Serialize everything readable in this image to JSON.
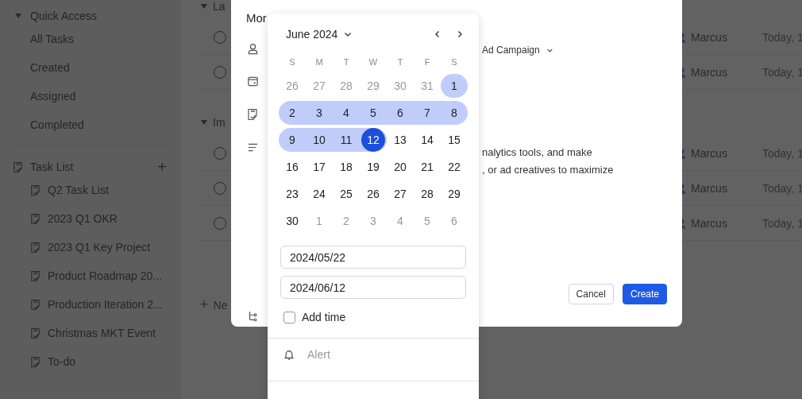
{
  "sidebar": {
    "quick_access": {
      "title": "Quick Access",
      "expanded": true,
      "items": [
        {
          "label": "All Tasks"
        },
        {
          "label": "Created"
        },
        {
          "label": "Assigned"
        },
        {
          "label": "Completed"
        }
      ]
    },
    "task_list": {
      "title": "Task List",
      "add": "+",
      "items": [
        {
          "label": "Q2 Task List"
        },
        {
          "label": "2023 Q1 OKR"
        },
        {
          "label": "2023 Q1 Key Project"
        },
        {
          "label": "Product Roadmap 20..."
        },
        {
          "label": "Production Iteration 2..."
        },
        {
          "label": "Christmas MKT Event"
        },
        {
          "label": "To-do"
        }
      ]
    }
  },
  "task_groups": [
    {
      "title": "La",
      "expanded": true,
      "rows": [
        {
          "checked": false,
          "assignee": "Marcus",
          "due": "Today, 1"
        },
        {
          "checked": false,
          "assignee": "Marcus",
          "due": "Today, 1"
        }
      ]
    },
    {
      "title": "Im",
      "expanded": true,
      "rows": [
        {
          "checked": false,
          "assignee": "Marcus",
          "due": "Today, 1"
        },
        {
          "checked": false,
          "assignee": "Marcus",
          "due": "Today, 1"
        },
        {
          "checked": false,
          "assignee": "Marcus",
          "due": "Today, 1"
        }
      ]
    }
  ],
  "new_task": {
    "icon": "+",
    "label": "Ne"
  },
  "dialog": {
    "title": "Mor",
    "task_list": "Ad Campaign",
    "description_lines": [
      "nalytics tools, and make",
      ", or ad creatives to maximize"
    ],
    "buttons": [
      {
        "label": "Cancel",
        "kind": "secondary"
      },
      {
        "label": "Create",
        "kind": "primary"
      }
    ]
  },
  "date_picker": {
    "month": "June 2024",
    "weekdays": [
      "S",
      "M",
      "T",
      "W",
      "T",
      "F",
      "S"
    ],
    "weeks": [
      [
        {
          "day": "26",
          "muted": true,
          "in_range": false,
          "selected": false
        },
        {
          "day": "27",
          "muted": true,
          "in_range": false,
          "selected": false
        },
        {
          "day": "28",
          "muted": true,
          "in_range": false,
          "selected": false
        },
        {
          "day": "29",
          "muted": true,
          "in_range": false,
          "selected": false
        },
        {
          "day": "30",
          "muted": true,
          "in_range": false,
          "selected": false
        },
        {
          "day": "31",
          "muted": true,
          "in_range": false,
          "selected": false
        },
        {
          "day": "1",
          "muted": false,
          "in_range": true,
          "selected": false
        }
      ],
      [
        {
          "day": "2",
          "muted": false,
          "in_range": true,
          "selected": false
        },
        {
          "day": "3",
          "muted": false,
          "in_range": true,
          "selected": false
        },
        {
          "day": "4",
          "muted": false,
          "in_range": true,
          "selected": false
        },
        {
          "day": "5",
          "muted": false,
          "in_range": true,
          "selected": false
        },
        {
          "day": "6",
          "muted": false,
          "in_range": true,
          "selected": false
        },
        {
          "day": "7",
          "muted": false,
          "in_range": true,
          "selected": false
        },
        {
          "day": "8",
          "muted": false,
          "in_range": true,
          "selected": false
        }
      ],
      [
        {
          "day": "9",
          "muted": false,
          "in_range": true,
          "selected": false
        },
        {
          "day": "10",
          "muted": false,
          "in_range": true,
          "selected": false
        },
        {
          "day": "11",
          "muted": false,
          "in_range": true,
          "selected": false
        },
        {
          "day": "12",
          "muted": false,
          "in_range": true,
          "selected": true
        },
        {
          "day": "13",
          "muted": false,
          "in_range": false,
          "selected": false
        },
        {
          "day": "14",
          "muted": false,
          "in_range": false,
          "selected": false
        },
        {
          "day": "15",
          "muted": false,
          "in_range": false,
          "selected": false
        }
      ],
      [
        {
          "day": "16",
          "muted": false,
          "in_range": false,
          "selected": false
        },
        {
          "day": "17",
          "muted": false,
          "in_range": false,
          "selected": false
        },
        {
          "day": "18",
          "muted": false,
          "in_range": false,
          "selected": false
        },
        {
          "day": "19",
          "muted": false,
          "in_range": false,
          "selected": false
        },
        {
          "day": "20",
          "muted": false,
          "in_range": false,
          "selected": false
        },
        {
          "day": "21",
          "muted": false,
          "in_range": false,
          "selected": false
        },
        {
          "day": "22",
          "muted": false,
          "in_range": false,
          "selected": false
        }
      ],
      [
        {
          "day": "23",
          "muted": false,
          "in_range": false,
          "selected": false
        },
        {
          "day": "24",
          "muted": false,
          "in_range": false,
          "selected": false
        },
        {
          "day": "25",
          "muted": false,
          "in_range": false,
          "selected": false
        },
        {
          "day": "26",
          "muted": false,
          "in_range": false,
          "selected": false
        },
        {
          "day": "27",
          "muted": false,
          "in_range": false,
          "selected": false
        },
        {
          "day": "28",
          "muted": false,
          "in_range": false,
          "selected": false
        },
        {
          "day": "29",
          "muted": false,
          "in_range": false,
          "selected": false
        }
      ],
      [
        {
          "day": "30",
          "muted": false,
          "in_range": false,
          "selected": false
        },
        {
          "day": "1",
          "muted": true,
          "in_range": false,
          "selected": false
        },
        {
          "day": "2",
          "muted": true,
          "in_range": false,
          "selected": false
        },
        {
          "day": "3",
          "muted": true,
          "in_range": false,
          "selected": false
        },
        {
          "day": "4",
          "muted": true,
          "in_range": false,
          "selected": false
        },
        {
          "day": "5",
          "muted": true,
          "in_range": false,
          "selected": false
        },
        {
          "day": "6",
          "muted": true,
          "in_range": false,
          "selected": false
        }
      ]
    ],
    "start_date": "2024/05/22",
    "end_date": "2024/06/12",
    "add_time": {
      "label": "Add time",
      "checked": false
    },
    "alert": {
      "label": "Alert"
    }
  }
}
